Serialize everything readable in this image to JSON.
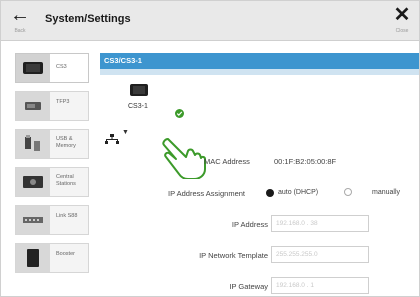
{
  "header": {
    "back_caption": "Back",
    "title": "System/Settings",
    "close_caption": "Close"
  },
  "sidebar": {
    "items": [
      {
        "label": "CS3",
        "icon": "cs3-device-icon",
        "active": true
      },
      {
        "label": "TFP3",
        "icon": "tfp3-device-icon",
        "active": false
      },
      {
        "label": "USB &\nMemory",
        "icon": "usb-memory-icon",
        "active": false
      },
      {
        "label": "Central\nStations",
        "icon": "central-station-icon",
        "active": false
      },
      {
        "label": "Link S88",
        "icon": "link-s88-icon",
        "active": false
      },
      {
        "label": "Booster",
        "icon": "booster-icon",
        "active": false
      }
    ]
  },
  "panel": {
    "selected_title": "CS3/CS3-1",
    "device_name": "CS3-1",
    "status": "connected"
  },
  "network": {
    "mac_label": "MAC Address",
    "mac_value": "00:1F:B2:05:00:8F",
    "assignment_label": "IP Address Assignment",
    "option_auto": "auto (DHCP)",
    "option_manual": "manually",
    "selected_option": "auto",
    "ip_label": "IP Address",
    "ip_value": "192.168.0 . 38",
    "template_label": "IP Network Template",
    "template_value": "255.255.255.0",
    "gateway_label": "IP Gateway",
    "gateway_value": "192.168.0 . 1"
  },
  "colors": {
    "accent": "#3d95cf",
    "accent_light": "#cfe3f1",
    "status_ok": "#3c9a2a"
  }
}
